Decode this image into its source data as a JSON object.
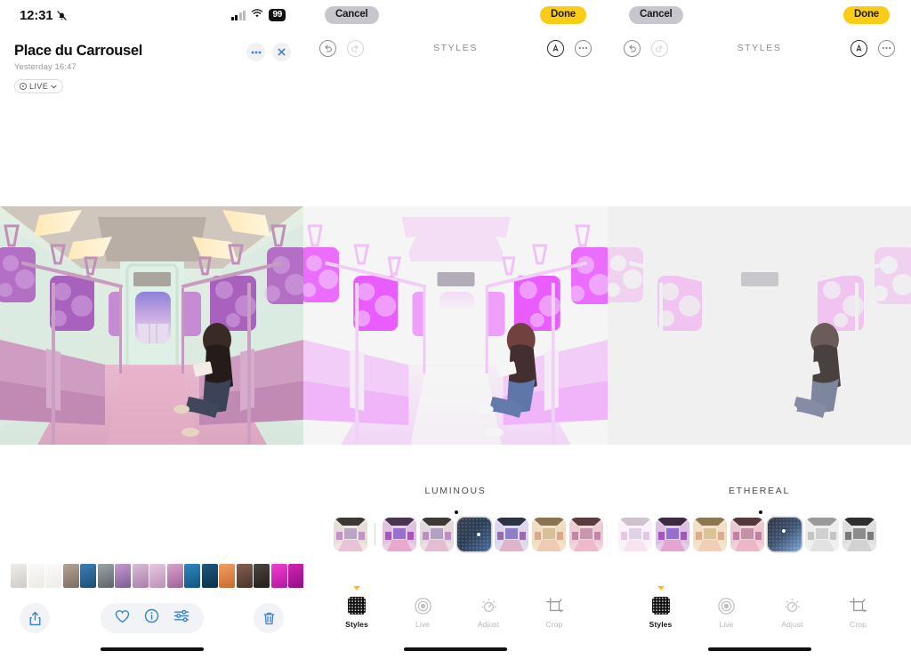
{
  "status_bar": {
    "time": "12:31",
    "mute_icon": "bell-slash-icon",
    "signal_icon": "cellular-signal-icon",
    "wifi_icon": "wifi-icon",
    "battery": "99"
  },
  "panel1": {
    "title": "Place du Carrousel",
    "subtitle": "Yesterday  16:47",
    "live_badge": "LIVE",
    "more_icon": "ellipsis-icon",
    "close_icon": "close-icon",
    "photo_alt": "train-interior-photo",
    "bottom_toolbar": {
      "share_label": "share-icon",
      "favorite_label": "heart-icon",
      "info_label": "info-icon",
      "adjust_label": "sliders-icon",
      "delete_label": "trash-icon"
    }
  },
  "panel2": {
    "cancel_label": "Cancel",
    "done_label": "Done",
    "edit_title": "STYLES",
    "undo_icon": "undo-icon",
    "redo_icon": "redo-icon",
    "markup_icon": "markup-pen-icon",
    "more_icon": "ellipsis-circle-icon",
    "style_name": "LUMINOUS",
    "selected_index": 3,
    "thumbs": [
      {
        "name": "style-thumb-original",
        "kind": "photo",
        "tone": "natural"
      },
      {
        "name": "style-thumb-vivid",
        "kind": "photo",
        "tone": "vivid"
      },
      {
        "name": "style-thumb-standard",
        "kind": "photo",
        "tone": "standard"
      },
      {
        "name": "style-thumb-luminous-grid",
        "kind": "grid",
        "tone": "grid"
      },
      {
        "name": "style-thumb-cool",
        "kind": "photo",
        "tone": "cool"
      },
      {
        "name": "style-thumb-warm",
        "kind": "photo",
        "tone": "warm"
      },
      {
        "name": "style-thumb-rose",
        "kind": "photo",
        "tone": "rose"
      },
      {
        "name": "style-thumb-pale",
        "kind": "photo",
        "tone": "pale"
      }
    ],
    "tabs": [
      {
        "label": "Styles",
        "icon": "styles-grid-icon",
        "active": true
      },
      {
        "label": "Live",
        "icon": "live-photo-icon",
        "active": false
      },
      {
        "label": "Adjust",
        "icon": "adjust-dial-icon",
        "active": false
      },
      {
        "label": "Crop",
        "icon": "crop-icon",
        "active": false
      }
    ]
  },
  "panel3": {
    "cancel_label": "Cancel",
    "done_label": "Done",
    "edit_title": "STYLES",
    "undo_icon": "undo-icon",
    "redo_icon": "redo-icon",
    "markup_icon": "markup-pen-icon",
    "more_icon": "ellipsis-circle-icon",
    "style_name": "ETHEREAL",
    "selected_index": 4,
    "thumbs": [
      {
        "name": "style-thumb-pale",
        "kind": "photo",
        "tone": "pale"
      },
      {
        "name": "style-thumb-vivid",
        "kind": "photo",
        "tone": "vivid"
      },
      {
        "name": "style-thumb-warm",
        "kind": "photo",
        "tone": "warm"
      },
      {
        "name": "style-thumb-rose",
        "kind": "photo",
        "tone": "rose"
      },
      {
        "name": "style-thumb-ethereal-grid",
        "kind": "grid",
        "tone": "grid"
      },
      {
        "name": "style-thumb-mono-light",
        "kind": "photo",
        "tone": "mono-light"
      },
      {
        "name": "style-thumb-mono-dark",
        "kind": "photo",
        "tone": "mono-dark"
      }
    ],
    "tabs": [
      {
        "label": "Styles",
        "icon": "styles-grid-icon",
        "active": true
      },
      {
        "label": "Live",
        "icon": "live-photo-icon",
        "active": false
      },
      {
        "label": "Adjust",
        "icon": "adjust-dial-icon",
        "active": false
      },
      {
        "label": "Crop",
        "icon": "crop-icon",
        "active": false
      }
    ]
  },
  "colors": {
    "accent_blue": "#3b82d6",
    "done_yellow": "#facc15",
    "cancel_grey": "#c6c6cc",
    "chip_grey": "#f1f3f6"
  },
  "filmstrip": [
    "#e8e6e2",
    "#f2f1ef",
    "#f4f3f1",
    "#9b8d83",
    "#2d5f8a",
    "#7d8489",
    "#b088b8",
    "#c9a6c4",
    "#d8b9d2",
    "#b77fae",
    "#1f6fa8",
    "#16415f",
    "#e28a52",
    "#6b4a3a",
    "#3a3330",
    "#e033c0",
    "#c21fa8",
    "#f0a8e0"
  ]
}
